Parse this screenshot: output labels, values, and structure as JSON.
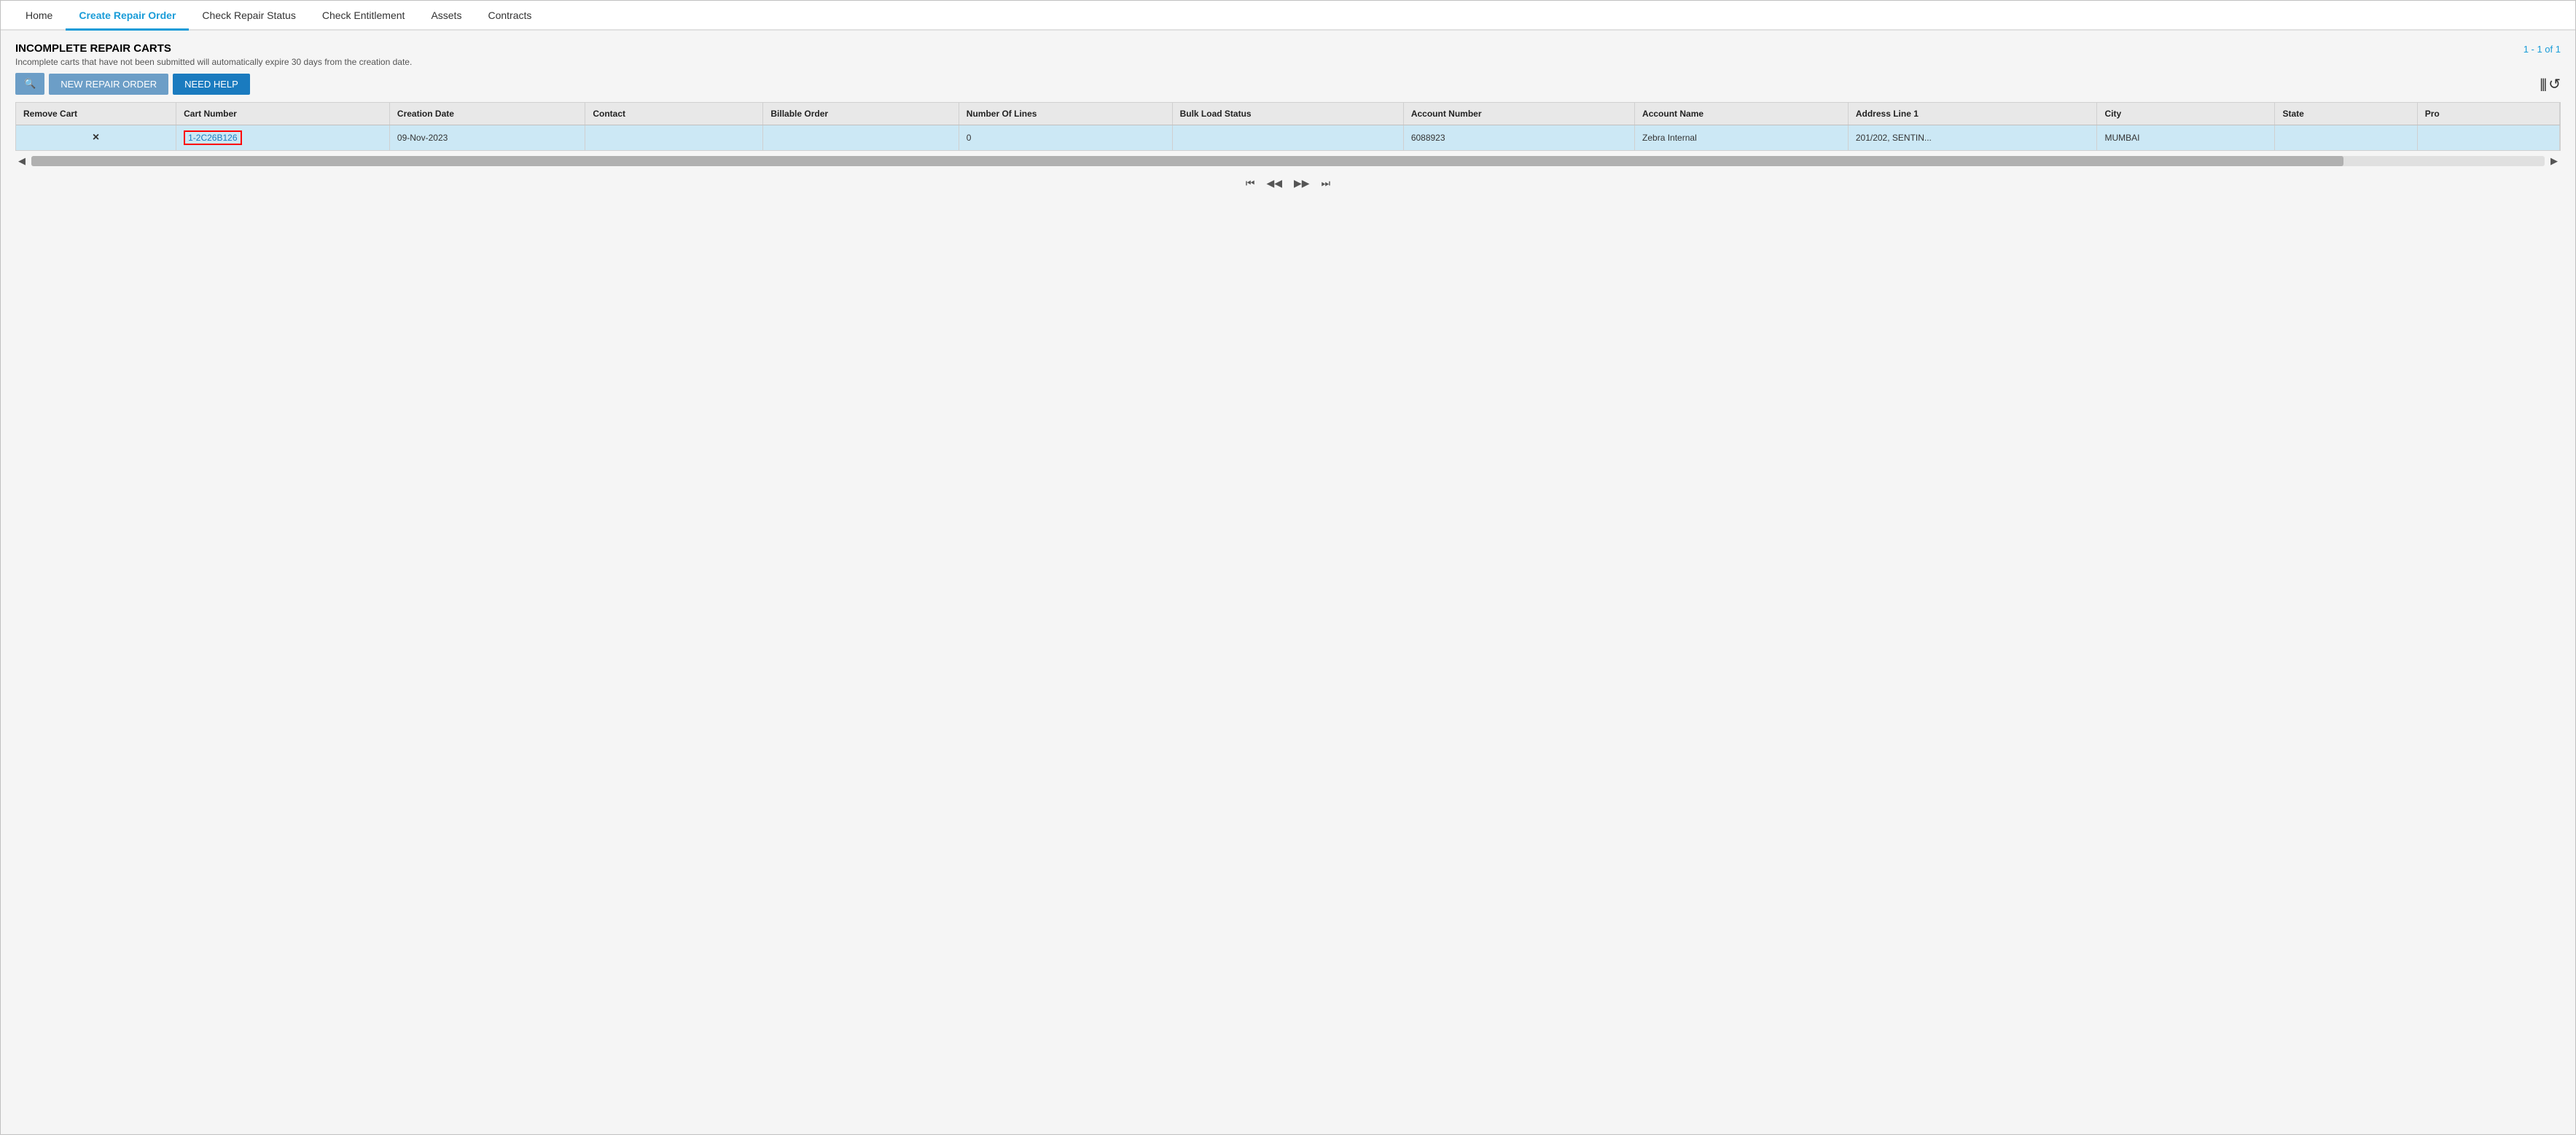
{
  "nav": {
    "items": [
      {
        "label": "Home",
        "id": "home",
        "active": false
      },
      {
        "label": "Create Repair Order",
        "id": "create-repair-order",
        "active": true
      },
      {
        "label": "Check Repair Status",
        "id": "check-repair-status",
        "active": false
      },
      {
        "label": "Check Entitlement",
        "id": "check-entitlement",
        "active": false
      },
      {
        "label": "Assets",
        "id": "assets",
        "active": false
      },
      {
        "label": "Contracts",
        "id": "contracts",
        "active": false
      }
    ]
  },
  "section": {
    "title": "INCOMPLETE REPAIR CARTS",
    "subtitle": "Incomplete carts that have not been submitted will automatically expire 30 days from the creation date.",
    "pagination": "1 - 1 of 1"
  },
  "toolbar": {
    "search_label": "🔍",
    "new_order_label": "NEW REPAIR ORDER",
    "need_help_label": "NEED HELP",
    "columns_icon": "|||",
    "refresh_icon": "↺"
  },
  "table": {
    "columns": [
      {
        "id": "remove-cart",
        "label": "Remove Cart"
      },
      {
        "id": "cart-number",
        "label": "Cart Number"
      },
      {
        "id": "creation-date",
        "label": "Creation Date"
      },
      {
        "id": "contact",
        "label": "Contact"
      },
      {
        "id": "billable-order",
        "label": "Billable Order"
      },
      {
        "id": "number-of-lines",
        "label": "Number Of Lines"
      },
      {
        "id": "bulk-load-status",
        "label": "Bulk Load Status"
      },
      {
        "id": "account-number",
        "label": "Account Number"
      },
      {
        "id": "account-name",
        "label": "Account Name"
      },
      {
        "id": "address-line-1",
        "label": "Address Line 1"
      },
      {
        "id": "city",
        "label": "City"
      },
      {
        "id": "state",
        "label": "State"
      },
      {
        "id": "pro",
        "label": "Pro"
      }
    ],
    "rows": [
      {
        "remove_cart": "×",
        "cart_number": "1-2C26B126",
        "creation_date": "09-Nov-2023",
        "contact": "",
        "billable_order": "",
        "number_of_lines": "0",
        "bulk_load_status": "",
        "account_number": "6088923",
        "account_name": "Zebra Internal",
        "address_line_1": "201/202, SENTIN...",
        "city": "MUMBAI",
        "state": "",
        "pro": ""
      }
    ]
  },
  "pagination_controls": {
    "first": "⏮",
    "prev": "◀",
    "next": "▶",
    "last": "⏭"
  }
}
